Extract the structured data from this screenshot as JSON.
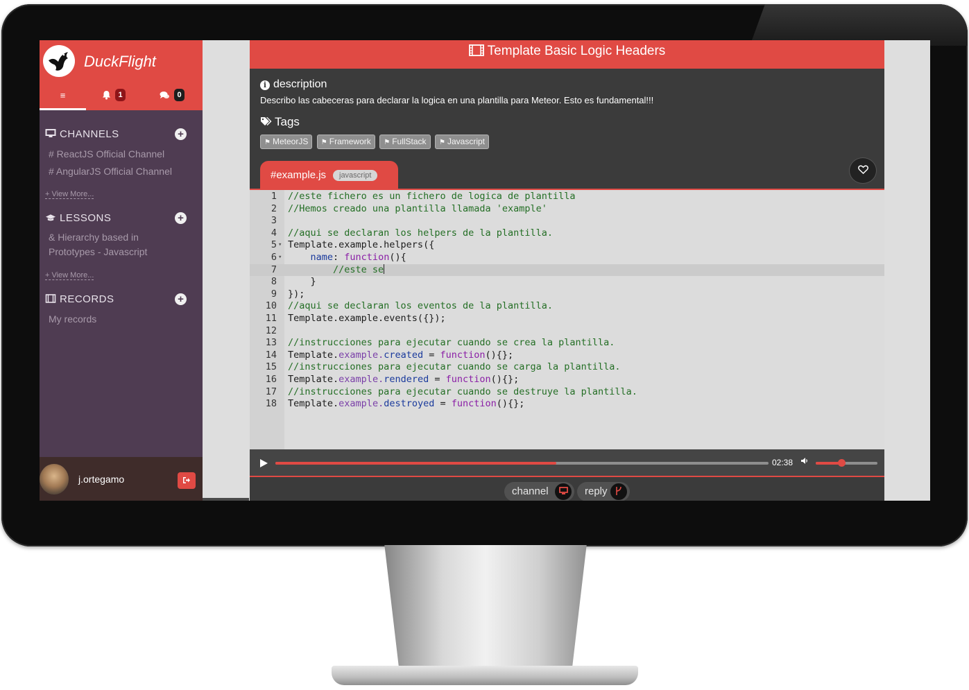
{
  "app": {
    "brand": "DuckFlight",
    "accent_color": "#e04a44",
    "sidebar_color": "#4f3c52"
  },
  "sidebar": {
    "tabs": [
      {
        "icon": "menu-icon",
        "glyph": "≡"
      },
      {
        "icon": "bell-icon",
        "badge": "1"
      },
      {
        "icon": "chat-icon",
        "badge": "0"
      }
    ],
    "channels": {
      "title": "CHANNELS",
      "items": [
        "# ReactJS Official Channel",
        "# AngularJS Official Channel"
      ],
      "more": "+ View More..."
    },
    "lessons": {
      "title": "LESSONS",
      "items": [
        "& Hierarchy based in Prototypes - Javascript"
      ],
      "more": "+ View More..."
    },
    "records": {
      "title": "RECORDS",
      "items": [
        "My records"
      ]
    },
    "user": {
      "name": "j.ortegamo"
    }
  },
  "card": {
    "title": "Template Basic Logic Headers",
    "description_label": "description",
    "description": "Describo las cabeceras para declarar la logica en una plantilla para Meteor. Esto es fundamental!!!",
    "tags_label": "Tags",
    "tags": [
      "MeteorJS",
      "Framework",
      "FullStack",
      "Javascript"
    ],
    "file": {
      "name": "#example.js",
      "language": "javascript"
    }
  },
  "code": {
    "lines": [
      {
        "n": "1",
        "t": "//este fichero es un fichero de logica de plantilla"
      },
      {
        "n": "2",
        "t": "//Hemos creado una plantilla llamada 'example'"
      },
      {
        "n": "3",
        "t": ""
      },
      {
        "n": "4",
        "t": "//aqui se declaran los helpers de la plantilla."
      },
      {
        "n": "5",
        "t": "Template.example.helpers({"
      },
      {
        "n": "6",
        "t": "    name: function(){"
      },
      {
        "n": "7",
        "t": "        //este se"
      },
      {
        "n": "8",
        "t": "    }"
      },
      {
        "n": "9",
        "t": "});"
      },
      {
        "n": "10",
        "t": "//aqui se declaran los eventos de la plantilla."
      },
      {
        "n": "11",
        "t": "Template.example.events({});"
      },
      {
        "n": "12",
        "t": ""
      },
      {
        "n": "13",
        "t": "//instrucciones para ejecutar cuando se crea la plantilla."
      },
      {
        "n": "14",
        "t": "Template.example.created = function(){};"
      },
      {
        "n": "15",
        "t": "//instrucciones para ejecutar cuando se carga la plantilla."
      },
      {
        "n": "16",
        "t": "Template.example.rendered = function(){};"
      },
      {
        "n": "17",
        "t": "//instrucciones para ejecutar cuando se destruye la plantilla."
      },
      {
        "n": "18",
        "t": "Template.example.destroyed = function(){};"
      }
    ],
    "active_line": "7"
  },
  "player": {
    "time": "02:38",
    "progress": 0.57,
    "volume": 0.42
  },
  "actions": {
    "channel_label": "channel",
    "reply_label": "reply"
  }
}
